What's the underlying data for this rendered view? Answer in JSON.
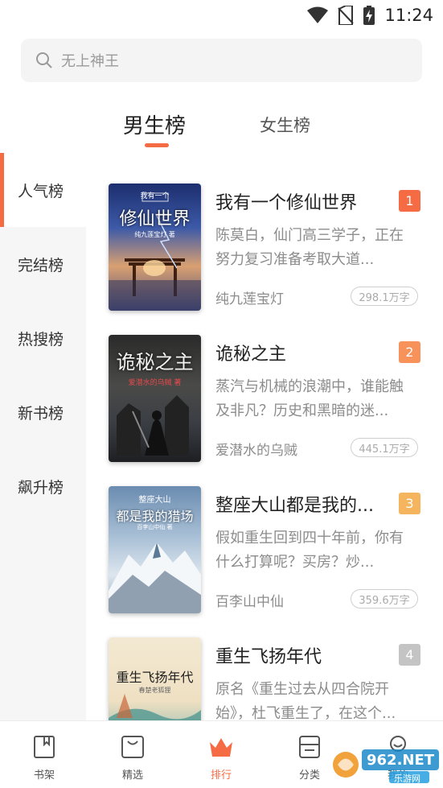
{
  "status_bar": {
    "time": "11:24",
    "icons": [
      "wifi-icon",
      "no-sim-icon",
      "battery-charging-icon"
    ]
  },
  "search": {
    "placeholder": "无上神王"
  },
  "gender_tabs": [
    {
      "label": "男生榜",
      "selected": true
    },
    {
      "label": "女生榜",
      "selected": false
    }
  ],
  "categories": [
    {
      "label": "人气榜",
      "selected": true
    },
    {
      "label": "完结榜",
      "selected": false
    },
    {
      "label": "热搜榜",
      "selected": false
    },
    {
      "label": "新书榜",
      "selected": false
    },
    {
      "label": "飙升榜",
      "selected": false
    }
  ],
  "books": [
    {
      "rank": "1",
      "rank_color": "#f56b43",
      "title": "我有一个修仙世界",
      "desc": "陈莫白，仙门高三学子，正在努力复习准备考取大道...",
      "author": "纯九莲宝灯",
      "words": "298.1万字",
      "cover_title": "修仙世界",
      "cover_sub": "我有一个",
      "cover_author": "纯九莲宝灯 著"
    },
    {
      "rank": "2",
      "rank_color": "#f7925a",
      "title": "诡秘之主",
      "desc": "蒸汽与机械的浪潮中，谁能触及非凡？历史和黑暗的迷...",
      "author": "爱潜水的乌贼",
      "words": "445.1万字",
      "cover_title": "诡秘之主",
      "cover_sub": "",
      "cover_author": "爱潜水的乌贼 著"
    },
    {
      "rank": "3",
      "rank_color": "#f5b55e",
      "title": "整座大山都是我的...",
      "desc": "假如重生回到四十年前，你有什么打算呢？买房？炒...",
      "author": "百李山中仙",
      "words": "359.6万字",
      "cover_title": "都是我的猎场",
      "cover_sub": "整座大山",
      "cover_author": "百李山中仙 著"
    },
    {
      "rank": "4",
      "rank_color": "#c4c4c4",
      "title": "重生飞扬年代",
      "desc": "原名《重生过去从四合院开始》，杜飞重生了，在这个...",
      "author": "",
      "words": "",
      "cover_title": "重生飞扬年代",
      "cover_sub": "",
      "cover_author": "春楚老狐狸"
    }
  ],
  "bottom_nav": [
    {
      "label": "书架",
      "icon": "bookshelf-icon",
      "selected": false
    },
    {
      "label": "精选",
      "icon": "featured-icon",
      "selected": false
    },
    {
      "label": "排行",
      "icon": "crown-icon",
      "selected": true
    },
    {
      "label": "分类",
      "icon": "category-icon",
      "selected": false
    },
    {
      "label": "我的",
      "icon": "profile-icon",
      "selected": false
    }
  ],
  "watermark": {
    "text": "962.NET",
    "sub": "乐游网"
  },
  "colors": {
    "accent": "#f56b43",
    "nav_bg": "#f6f6f6"
  }
}
